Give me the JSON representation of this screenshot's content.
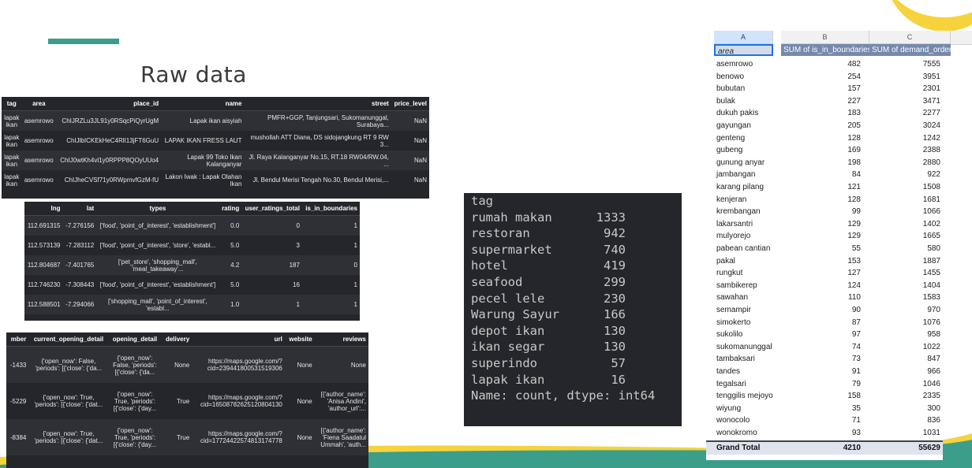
{
  "slide": {
    "title": "Raw data"
  },
  "df1": {
    "columns": [
      "tag",
      "area",
      "place_id",
      "name",
      "street",
      "price_level"
    ],
    "rows": [
      [
        "lapak\nikan",
        "asemrowo",
        "ChIJRZLu3JL91y0RSqcPiQyrUgM",
        "Lapak ikan aisyiah",
        "PMFR+GGP, Tanjungsari, Sukomanunggal,\nSurabaya...",
        "NaN"
      ],
      [
        "lapak\nikan",
        "asemrowo",
        "ChIJlbICKEkHeC4RlI13jFT6GuU",
        "LAPAK IKAN FRESS LAUT",
        "mushollah ATT Diana, DS sidojangkung RT 9 RW\n3...",
        "NaN"
      ],
      [
        "lapak\nikan",
        "asemrowo",
        "ChIJ0wtKh4vl1y0RPPP8QOyUUo4",
        "Lapak 99 Toko Ikan\nKalanganyar",
        "Jl. Raya Kalanganyar No.15, RT.18 RW04/RW.04,\n...",
        "NaN"
      ],
      [
        "lapak\nikan",
        "asemrowo",
        "ChIJheCVSf71y0RWpmvfGzM-fU",
        "Lakon Iwak : Lapak Olahan\nIkan",
        "Jl. Bendul Merisi Tengah No.30, Bendul Merisi,...",
        "NaN"
      ]
    ]
  },
  "df2": {
    "columns": [
      "lng",
      "lat",
      "types",
      "rating",
      "user_ratings_total",
      "is_in_boundaries"
    ],
    "rows": [
      [
        "112.691315",
        "-7.276156",
        "['food', 'point_of_interest', 'establishment']",
        "0.0",
        "0",
        "1"
      ],
      [
        "112.573139",
        "-7.283112",
        "['food', 'point_of_interest', 'store', 'establ...",
        "5.0",
        "3",
        "1"
      ],
      [
        "112.804687",
        "-7.401765",
        "['pet_store', 'shopping_mall',\n'meal_takeaway'...",
        "4.2",
        "187",
        "0"
      ],
      [
        "112.746230",
        "-7.308443",
        "['food', 'point_of_interest', 'establishment']",
        "5.0",
        "16",
        "1"
      ],
      [
        "112.588501",
        "-7.294066",
        "['shopping_mall', 'point_of_interest',\n'establ...",
        "1.0",
        "1",
        "1"
      ]
    ]
  },
  "df3": {
    "columns": [
      "mber",
      "current_opening_detail",
      "opening_detail",
      "delivery",
      "url",
      "website",
      "reviews"
    ],
    "rows": [
      [
        "-1433",
        "{'open_now': False,\n'periods': [{'close': {'da...",
        "{'open_now':\nFalse, 'periods':\n[{'close': {'da...",
        "None",
        "https://maps.google.com/?\ncid=239441800531519306",
        "None",
        "None"
      ],
      [
        "-5229",
        "{'open_now': True,\n'periods': [{'close': {'dat...",
        "{'open_now':\nTrue, 'periods':\n[{'close': {'day...",
        "True",
        "https://maps.google.com/?\ncid=16508782625120804130",
        "None",
        "[{'author_name':\n'Anisa Andini',\n'author_url':..."
      ],
      [
        "-8384",
        "{'open_now': True,\n'periods': [{'close': {'dat...",
        "{'open_now':\nTrue, 'periods':\n[{'close': {'day...",
        "True",
        "https://maps.google.com/?\ncid=17724422574813174778",
        "None",
        "[{'author_name':\n'Fiena Saadatul\nUmmah', 'auth..."
      ]
    ]
  },
  "value_counts": {
    "header": "tag",
    "items": [
      {
        "label": "rumah makan",
        "count": "1333"
      },
      {
        "label": "restoran",
        "count": "942"
      },
      {
        "label": "supermarket",
        "count": "740"
      },
      {
        "label": "hotel",
        "count": "419"
      },
      {
        "label": "seafood",
        "count": "299"
      },
      {
        "label": "pecel lele",
        "count": "230"
      },
      {
        "label": "Warung Sayur",
        "count": "166"
      },
      {
        "label": "depot ikan",
        "count": "130"
      },
      {
        "label": "ikan segar",
        "count": "130"
      },
      {
        "label": "superindo",
        "count": "57"
      },
      {
        "label": "lapak ikan",
        "count": "16"
      }
    ],
    "footer": "Name: count, dtype: int64"
  },
  "pivot": {
    "col_letters": [
      "A",
      "B",
      "C"
    ],
    "headers": [
      "area",
      "SUM of is_in_boundaries",
      "SUM of demand_order"
    ],
    "rows": [
      [
        "asemrowo",
        "482",
        "7555"
      ],
      [
        "benowo",
        "254",
        "3951"
      ],
      [
        "bubutan",
        "157",
        "2301"
      ],
      [
        "bulak",
        "227",
        "3471"
      ],
      [
        "dukuh pakis",
        "183",
        "2277"
      ],
      [
        "gayungan",
        "205",
        "3024"
      ],
      [
        "genteng",
        "128",
        "1242"
      ],
      [
        "gubeng",
        "169",
        "2388"
      ],
      [
        "gunung anyar",
        "198",
        "2880"
      ],
      [
        "jambangan",
        "84",
        "922"
      ],
      [
        "karang pilang",
        "121",
        "1508"
      ],
      [
        "kenjeran",
        "128",
        "1681"
      ],
      [
        "krembangan",
        "99",
        "1066"
      ],
      [
        "lakarsantri",
        "129",
        "1402"
      ],
      [
        "mulyorejo",
        "129",
        "1665"
      ],
      [
        "pabean cantian",
        "55",
        "580"
      ],
      [
        "pakal",
        "153",
        "1887"
      ],
      [
        "rungkut",
        "127",
        "1455"
      ],
      [
        "sambikerep",
        "124",
        "1404"
      ],
      [
        "sawahan",
        "110",
        "1583"
      ],
      [
        "semampir",
        "90",
        "970"
      ],
      [
        "simokerto",
        "87",
        "1076"
      ],
      [
        "sukolilo",
        "97",
        "958"
      ],
      [
        "sukomanunggal",
        "74",
        "1022"
      ],
      [
        "tambaksari",
        "73",
        "847"
      ],
      [
        "tandes",
        "91",
        "966"
      ],
      [
        "tegalsari",
        "79",
        "1046"
      ],
      [
        "tenggilis mejoyo",
        "158",
        "2335"
      ],
      [
        "wiyung",
        "35",
        "300"
      ],
      [
        "wonocolo",
        "71",
        "836"
      ],
      [
        "wonokromo",
        "93",
        "1031"
      ]
    ],
    "grand_total": [
      "Grand Total",
      "4210",
      "55629"
    ]
  }
}
